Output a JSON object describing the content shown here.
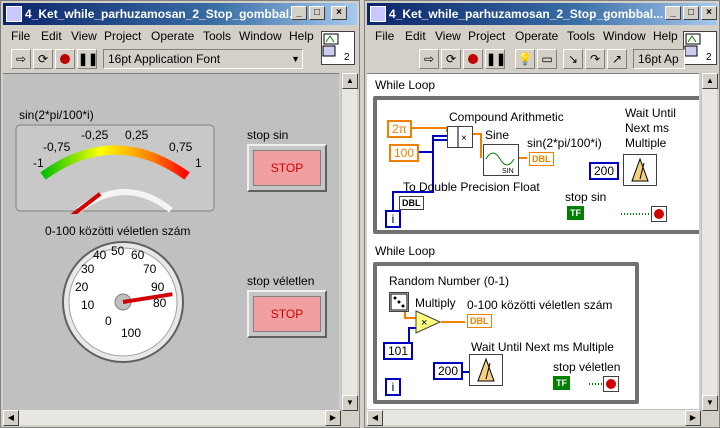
{
  "front_window": {
    "title": "4_Ket_while_parhuzamosan_2_Stop_gombbal...",
    "menus": [
      "File",
      "Edit",
      "View",
      "Project",
      "Operate",
      "Tools",
      "Window",
      "Help"
    ],
    "font_select": "16pt Application Font",
    "gauge_label": "sin(2*pi/100*i)",
    "gauge_ticks": [
      "-1",
      "-0,75",
      "-0,25",
      "0,25",
      "0,75",
      "1"
    ],
    "gauge_value": -0.62,
    "stop_sin_label": "stop sin",
    "stop_sin_text": "STOP",
    "dial_label": "0-100 közötti véletlen szám",
    "dial_ticks": [
      "0",
      "10",
      "20",
      "30",
      "40",
      "50",
      "60",
      "70",
      "80",
      "90",
      "100"
    ],
    "dial_value": 80,
    "stop_rand_label": "stop véletlen",
    "stop_rand_text": "STOP"
  },
  "diagram_window": {
    "title": "4_Ket_while_parhuzamosan_2_Stop_gombbal...",
    "menus": [
      "File",
      "Edit",
      "View",
      "Project",
      "Operate",
      "Tools",
      "Window",
      "Help"
    ],
    "font_select": "16pt Ap",
    "loop1": {
      "label": "While Loop",
      "two_pi": "2π",
      "const_100": "100",
      "compound_label": "Compound Arithmetic",
      "sine_label": "Sine",
      "sine_term": "SIN",
      "indicator_label": "sin(2*pi/100*i)",
      "dbl": "DBL",
      "wait_label": "Wait Until Next ms Multiple",
      "const_200": "200",
      "todbl_label": "To Double Precision Float",
      "stop_label": "stop sin",
      "tf": "TF",
      "iter": "i"
    },
    "loop2": {
      "label": "While Loop",
      "random_label": "Random Number (0-1)",
      "multiply_label": "Multiply",
      "indicator_label": "0-100 közötti véletlen szám",
      "dbl": "DBL",
      "const_101": "101",
      "wait_label": "Wait Until Next ms Multiple",
      "const_200": "200",
      "stop_label": "stop véletlen",
      "tf": "TF",
      "iter": "i"
    }
  },
  "colors": {
    "orange": "#f08000",
    "blue": "#0000c0",
    "green": "#008000"
  }
}
